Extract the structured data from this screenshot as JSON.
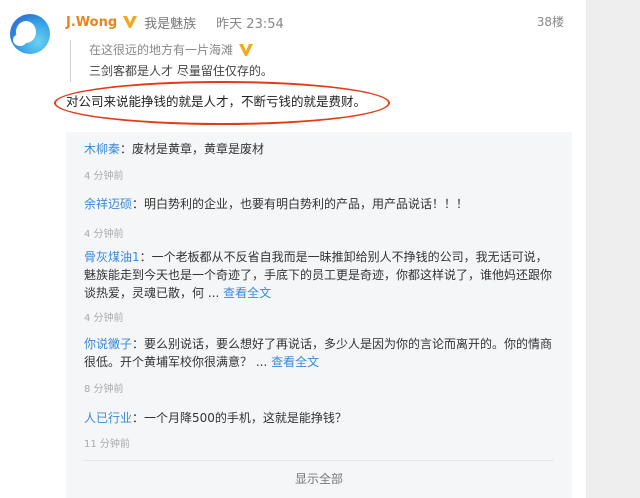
{
  "post": {
    "username": "J.Wong",
    "user_tag": "我是魅族",
    "timestamp": "昨天 23:54",
    "floor": "38楼",
    "quote_line1": "在这很远的地方有一片海滩",
    "quote_line2": "三剑客都是人才 尽量留住仅存的。",
    "main_text": "对公司来说能挣钱的就是人才，不断亏钱的就是费财。"
  },
  "replies": [
    {
      "name": "木柳秦",
      "sep": "：",
      "text": "废材是黄章，黄章是废材",
      "more": "",
      "time": "4 分钟前"
    },
    {
      "name": "余祥迈硕",
      "sep": "：",
      "text": "明白势利的企业，也要有明白势利的产品，用产品说话！！！",
      "more": "",
      "time": "4 分钟前"
    },
    {
      "name": "骨灰煤油1",
      "sep": "：",
      "text": "一个老板都从不反省自我而是一昧推卸给别人不挣钱的公司，我无话可说，魅族能走到今天也是一个奇迹了，手底下的员工更是奇迹，你都这样说了，谁他妈还跟你谈热爱，灵魂已散，何 ... ",
      "more": "查看全文",
      "time": "4 分钟前"
    },
    {
      "name": "你说黴子",
      "sep": "：",
      "text": "要么别说话，要么想好了再说话，多少人是因为你的言论而离开的。你的情商很低。开个黄埔军校你很满意？ ... ",
      "more": "查看全文",
      "time": "8 分钟前"
    },
    {
      "name": "人已行业",
      "sep": "：",
      "text": "一个月降500的手机，这就是能挣钱？",
      "more": "",
      "time": "11 分钟前"
    }
  ],
  "show_all": "显示全部",
  "colors": {
    "username": "#e8841a",
    "reply_name": "#3b8ad8",
    "highlight": "#e03c17",
    "badge": "#f2a91c"
  },
  "icons": {
    "verified": "verified-v-icon",
    "avatar": "avatar-image"
  }
}
